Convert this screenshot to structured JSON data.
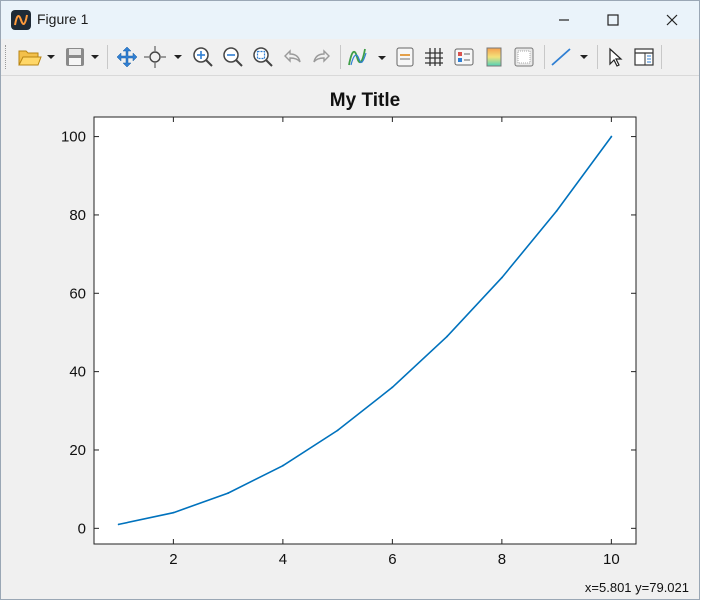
{
  "window": {
    "title": "Figure 1"
  },
  "toolbar": {
    "icons": [
      "open-folder-icon",
      "save-icon",
      "pan-icon",
      "zoom-cursor-icon",
      "zoom-in-icon",
      "zoom-out-icon",
      "zoom-fit-icon",
      "undo-icon",
      "redo-icon",
      "plot-style-icon",
      "legend-icon",
      "grid-icon",
      "axes-options-icon",
      "colormap-icon",
      "figure-frame-icon",
      "line-tool-icon",
      "select-cursor-icon",
      "property-panel-icon"
    ]
  },
  "status": {
    "cursor": "x=5.801 y=79.021"
  },
  "colors": {
    "line": "#0072bd",
    "titlebar": "#eaf3fa",
    "background": "#f0f0f0"
  },
  "chart_data": {
    "type": "line",
    "title": "My Title",
    "xlabel": "",
    "ylabel": "",
    "x": [
      1,
      2,
      3,
      4,
      5,
      6,
      7,
      8,
      9,
      10
    ],
    "series": [
      {
        "values": [
          1,
          4,
          9,
          16,
          25,
          36,
          49,
          64,
          81,
          100
        ]
      }
    ],
    "xlim": [
      0.55,
      10.45
    ],
    "ylim": [
      -4,
      105
    ],
    "xticks": [
      2,
      4,
      6,
      8,
      10
    ],
    "yticks": [
      0,
      20,
      40,
      60,
      80,
      100
    ],
    "grid": false
  }
}
